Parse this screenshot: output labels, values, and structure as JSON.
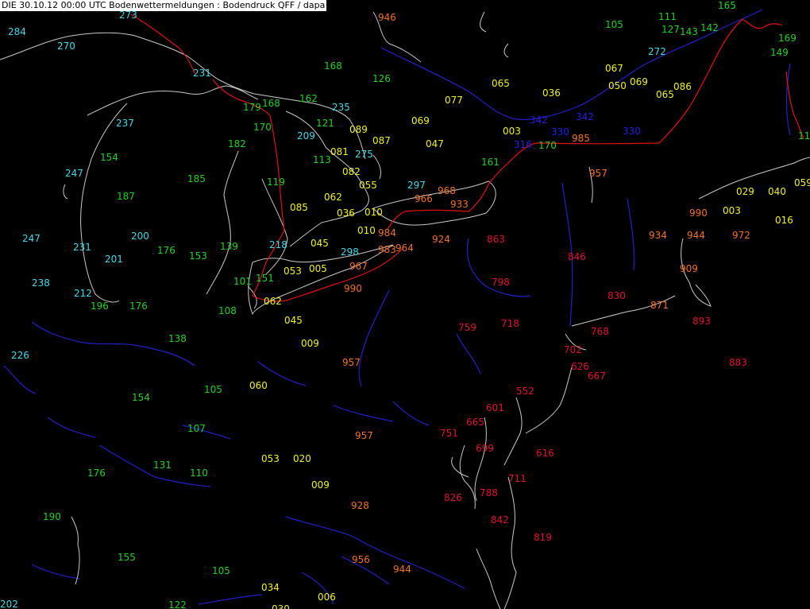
{
  "title": "DIE 30.10.12 00:00 UTC  Bodenwettermeldungen :  Bodendruck QFF / dapa",
  "colors": {
    "background": "#000000",
    "coastline": "#c8c8c8",
    "rivers": "#2020c8",
    "borders": "#e01010",
    "class_cyan": "#40d8e8",
    "class_green": "#20d020",
    "class_yellow": "#f0f020",
    "class_orange": "#f07020",
    "class_red": "#e01030",
    "class_blue": "#2020e0"
  },
  "observations": [
    {
      "v": "273",
      "c": "class_cyan"
    },
    {
      "v": "946",
      "c": "class_orange"
    },
    {
      "v": "165",
      "c": "class_green"
    },
    {
      "v": "284",
      "c": "class_cyan"
    },
    {
      "v": "111",
      "c": "class_green"
    },
    {
      "v": "105",
      "c": "class_green"
    },
    {
      "v": "127",
      "c": "class_green"
    },
    {
      "v": "143",
      "c": "class_green"
    },
    {
      "v": "142",
      "c": "class_green"
    },
    {
      "v": "169",
      "c": "class_green"
    },
    {
      "v": "270",
      "c": "class_cyan"
    },
    {
      "v": "272",
      "c": "class_cyan"
    },
    {
      "v": "149",
      "c": "class_green"
    },
    {
      "v": "168",
      "c": "class_green"
    },
    {
      "v": "231",
      "c": "class_cyan"
    },
    {
      "v": "067",
      "c": "class_yellow"
    },
    {
      "v": "126",
      "c": "class_green"
    },
    {
      "v": "065",
      "c": "class_yellow"
    },
    {
      "v": "050",
      "c": "class_yellow"
    },
    {
      "v": "069",
      "c": "class_yellow"
    },
    {
      "v": "086",
      "c": "class_yellow"
    },
    {
      "v": "036",
      "c": "class_yellow"
    },
    {
      "v": "065",
      "c": "class_yellow"
    },
    {
      "v": "162",
      "c": "class_green"
    },
    {
      "v": "077",
      "c": "class_yellow"
    },
    {
      "v": "179",
      "c": "class_green"
    },
    {
      "v": "168",
      "c": "class_green"
    },
    {
      "v": "235",
      "c": "class_cyan"
    },
    {
      "v": "342",
      "c": "class_blue"
    },
    {
      "v": "237",
      "c": "class_cyan"
    },
    {
      "v": "121",
      "c": "class_green"
    },
    {
      "v": "170",
      "c": "class_green"
    },
    {
      "v": "089",
      "c": "class_yellow"
    },
    {
      "v": "069",
      "c": "class_yellow"
    },
    {
      "v": "342",
      "c": "class_blue"
    },
    {
      "v": "003",
      "c": "class_yellow"
    },
    {
      "v": "330",
      "c": "class_blue"
    },
    {
      "v": "330",
      "c": "class_blue"
    },
    {
      "v": "209",
      "c": "class_cyan"
    },
    {
      "v": "087",
      "c": "class_yellow"
    },
    {
      "v": "985",
      "c": "class_orange"
    },
    {
      "v": "182",
      "c": "class_green"
    },
    {
      "v": "047",
      "c": "class_yellow"
    },
    {
      "v": "316",
      "c": "class_blue"
    },
    {
      "v": "170",
      "c": "class_green"
    },
    {
      "v": "081",
      "c": "class_yellow"
    },
    {
      "v": "275",
      "c": "class_cyan"
    },
    {
      "v": "154",
      "c": "class_green"
    },
    {
      "v": "113",
      "c": "class_green"
    },
    {
      "v": "161",
      "c": "class_green"
    },
    {
      "v": "082",
      "c": "class_yellow"
    },
    {
      "v": "247",
      "c": "class_cyan"
    },
    {
      "v": "957",
      "c": "class_orange"
    },
    {
      "v": "185",
      "c": "class_green"
    },
    {
      "v": "119",
      "c": "class_green"
    },
    {
      "v": "297",
      "c": "class_cyan"
    },
    {
      "v": "055",
      "c": "class_yellow"
    },
    {
      "v": "968",
      "c": "class_orange"
    },
    {
      "v": "187",
      "c": "class_green"
    },
    {
      "v": "062",
      "c": "class_yellow"
    },
    {
      "v": "966",
      "c": "class_orange"
    },
    {
      "v": "029",
      "c": "class_yellow"
    },
    {
      "v": "040",
      "c": "class_yellow"
    },
    {
      "v": "933",
      "c": "class_orange"
    },
    {
      "v": "085",
      "c": "class_yellow"
    },
    {
      "v": "010",
      "c": "class_yellow"
    },
    {
      "v": "990",
      "c": "class_orange"
    },
    {
      "v": "003",
      "c": "class_yellow"
    },
    {
      "v": "036",
      "c": "class_yellow"
    },
    {
      "v": "016",
      "c": "class_yellow"
    },
    {
      "v": "984",
      "c": "class_orange"
    },
    {
      "v": "010",
      "c": "class_yellow"
    },
    {
      "v": "934",
      "c": "class_orange"
    },
    {
      "v": "944",
      "c": "class_orange"
    },
    {
      "v": "972",
      "c": "class_orange"
    },
    {
      "v": "200",
      "c": "class_cyan"
    },
    {
      "v": "924",
      "c": "class_orange"
    },
    {
      "v": "863",
      "c": "class_red"
    },
    {
      "v": "247",
      "c": "class_cyan"
    },
    {
      "v": "045",
      "c": "class_yellow"
    },
    {
      "v": "139",
      "c": "class_green"
    },
    {
      "v": "231",
      "c": "class_cyan"
    },
    {
      "v": "218",
      "c": "class_cyan"
    },
    {
      "v": "983",
      "c": "class_orange"
    },
    {
      "v": "964",
      "c": "class_orange"
    },
    {
      "v": "176",
      "c": "class_green"
    },
    {
      "v": "298",
      "c": "class_cyan"
    },
    {
      "v": "153",
      "c": "class_green"
    },
    {
      "v": "201",
      "c": "class_cyan"
    },
    {
      "v": "846",
      "c": "class_red"
    },
    {
      "v": "967",
      "c": "class_orange"
    },
    {
      "v": "909",
      "c": "class_orange"
    },
    {
      "v": "053",
      "c": "class_yellow"
    },
    {
      "v": "005",
      "c": "class_yellow"
    },
    {
      "v": "151",
      "c": "class_green"
    },
    {
      "v": "238",
      "c": "class_cyan"
    },
    {
      "v": "101",
      "c": "class_green"
    },
    {
      "v": "798",
      "c": "class_red"
    },
    {
      "v": "990",
      "c": "class_orange"
    },
    {
      "v": "212",
      "c": "class_cyan"
    },
    {
      "v": "830",
      "c": "class_red"
    },
    {
      "v": "062",
      "c": "class_yellow"
    },
    {
      "v": "871",
      "c": "class_orange"
    },
    {
      "v": "196",
      "c": "class_green"
    },
    {
      "v": "176",
      "c": "class_green"
    },
    {
      "v": "108",
      "c": "class_green"
    },
    {
      "v": "893",
      "c": "class_red"
    },
    {
      "v": "045",
      "c": "class_yellow"
    },
    {
      "v": "718",
      "c": "class_red"
    },
    {
      "v": "759",
      "c": "class_red"
    },
    {
      "v": "768",
      "c": "class_red"
    },
    {
      "v": "138",
      "c": "class_green"
    },
    {
      "v": "009",
      "c": "class_yellow"
    },
    {
      "v": "702",
      "c": "class_red"
    },
    {
      "v": "226",
      "c": "class_cyan"
    },
    {
      "v": "957",
      "c": "class_orange"
    },
    {
      "v": "626",
      "c": "class_red"
    },
    {
      "v": "883",
      "c": "class_red"
    },
    {
      "v": "667",
      "c": "class_red"
    },
    {
      "v": "060",
      "c": "class_yellow"
    },
    {
      "v": "105",
      "c": "class_green"
    },
    {
      "v": "552",
      "c": "class_red"
    },
    {
      "v": "154",
      "c": "class_green"
    },
    {
      "v": "601",
      "c": "class_red"
    },
    {
      "v": "665",
      "c": "class_red"
    },
    {
      "v": "107",
      "c": "class_green"
    },
    {
      "v": "751",
      "c": "class_red"
    },
    {
      "v": "957",
      "c": "class_orange"
    },
    {
      "v": "699",
      "c": "class_red"
    },
    {
      "v": "053",
      "c": "class_yellow"
    },
    {
      "v": "020",
      "c": "class_yellow"
    },
    {
      "v": "616",
      "c": "class_red"
    },
    {
      "v": "131",
      "c": "class_green"
    },
    {
      "v": "176",
      "c": "class_green"
    },
    {
      "v": "110",
      "c": "class_green"
    },
    {
      "v": "711",
      "c": "class_red"
    },
    {
      "v": "009",
      "c": "class_yellow"
    },
    {
      "v": "788",
      "c": "class_red"
    },
    {
      "v": "928",
      "c": "class_orange"
    },
    {
      "v": "826",
      "c": "class_red"
    },
    {
      "v": "190",
      "c": "class_green"
    },
    {
      "v": "842",
      "c": "class_red"
    },
    {
      "v": "819",
      "c": "class_red"
    },
    {
      "v": "155",
      "c": "class_green"
    },
    {
      "v": "956",
      "c": "class_orange"
    },
    {
      "v": "944",
      "c": "class_orange"
    },
    {
      "v": "105",
      "c": "class_green"
    },
    {
      "v": "034",
      "c": "class_yellow"
    },
    {
      "v": "006",
      "c": "class_yellow"
    },
    {
      "v": "202",
      "c": "class_cyan"
    },
    {
      "v": "122",
      "c": "class_green"
    },
    {
      "v": "030",
      "c": "class_yellow"
    },
    {
      "v": "11",
      "c": "class_green"
    },
    {
      "v": "059",
      "c": "class_yellow"
    }
  ]
}
